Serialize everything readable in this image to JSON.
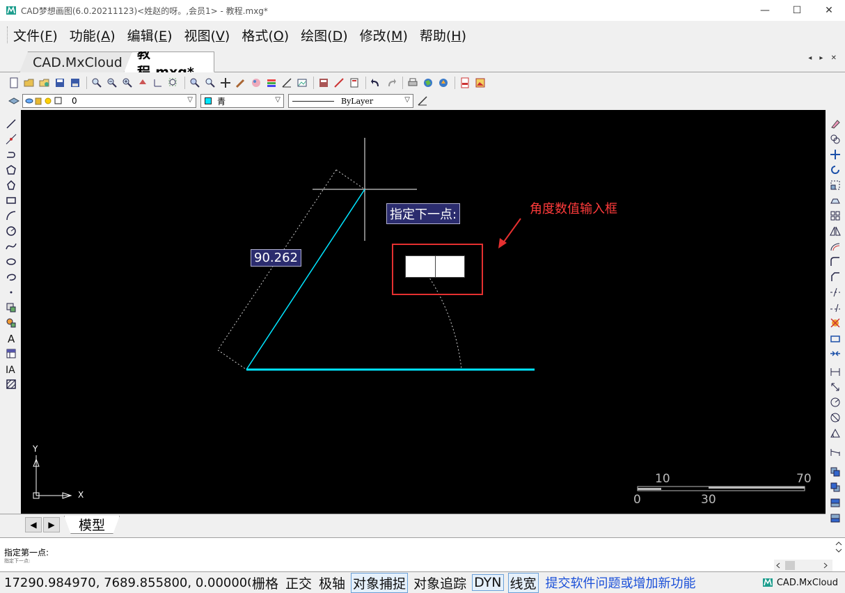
{
  "window": {
    "title": "CAD梦想画图(6.0.20211123)<姓赵的呀。,会员1> - 教程.mxg*",
    "minimize_glyph": "—",
    "maximize_glyph": "☐",
    "close_glyph": "✕"
  },
  "menu": [
    {
      "label": "文件(",
      "key": "F",
      "end": ")"
    },
    {
      "label": "功能(",
      "key": "A",
      "end": ")"
    },
    {
      "label": "编辑(",
      "key": "E",
      "end": ")"
    },
    {
      "label": "视图(",
      "key": "V",
      "end": ")"
    },
    {
      "label": "格式(",
      "key": "O",
      "end": ")"
    },
    {
      "label": "绘图(",
      "key": "D",
      "end": ")"
    },
    {
      "label": "修改(",
      "key": "M",
      "end": ")"
    },
    {
      "label": "帮助(",
      "key": "H",
      "end": ")"
    }
  ],
  "tabs": {
    "inactive": "CAD.MxCloud",
    "active": "教程.mxg*",
    "nav_glyphs": "◂ ▸ ✕"
  },
  "properties": {
    "layer": "0",
    "color": "青",
    "linetype": "ByLayer",
    "color_hex": "#00e5ff"
  },
  "canvas": {
    "prompt": "指定下一点:",
    "length_value": "90.262",
    "annotation": "角度数值输入框",
    "axis_y": "Y",
    "axis_x": "X",
    "scale_labels_top": [
      "10",
      "70"
    ],
    "scale_labels_bottom": [
      "0",
      "30"
    ],
    "line_color": "#00e5ff",
    "highlight_color": "#e53030"
  },
  "model_tab": {
    "label": "模型",
    "prev": "◀",
    "next": "▶"
  },
  "command": {
    "line1": "指定第一点:",
    "line2": "指定下一点:"
  },
  "status": {
    "coords": "17290.984970,  7689.855800,  0.000000",
    "grid": "栅格",
    "ortho": "正交",
    "polar": "极轴",
    "osnap": "对象捕捉",
    "otrack": "对象追踪",
    "dyn": "DYN",
    "lineweight": "线宽",
    "feedback": "提交软件问题或增加新功能",
    "brand": "CAD.MxCloud"
  }
}
